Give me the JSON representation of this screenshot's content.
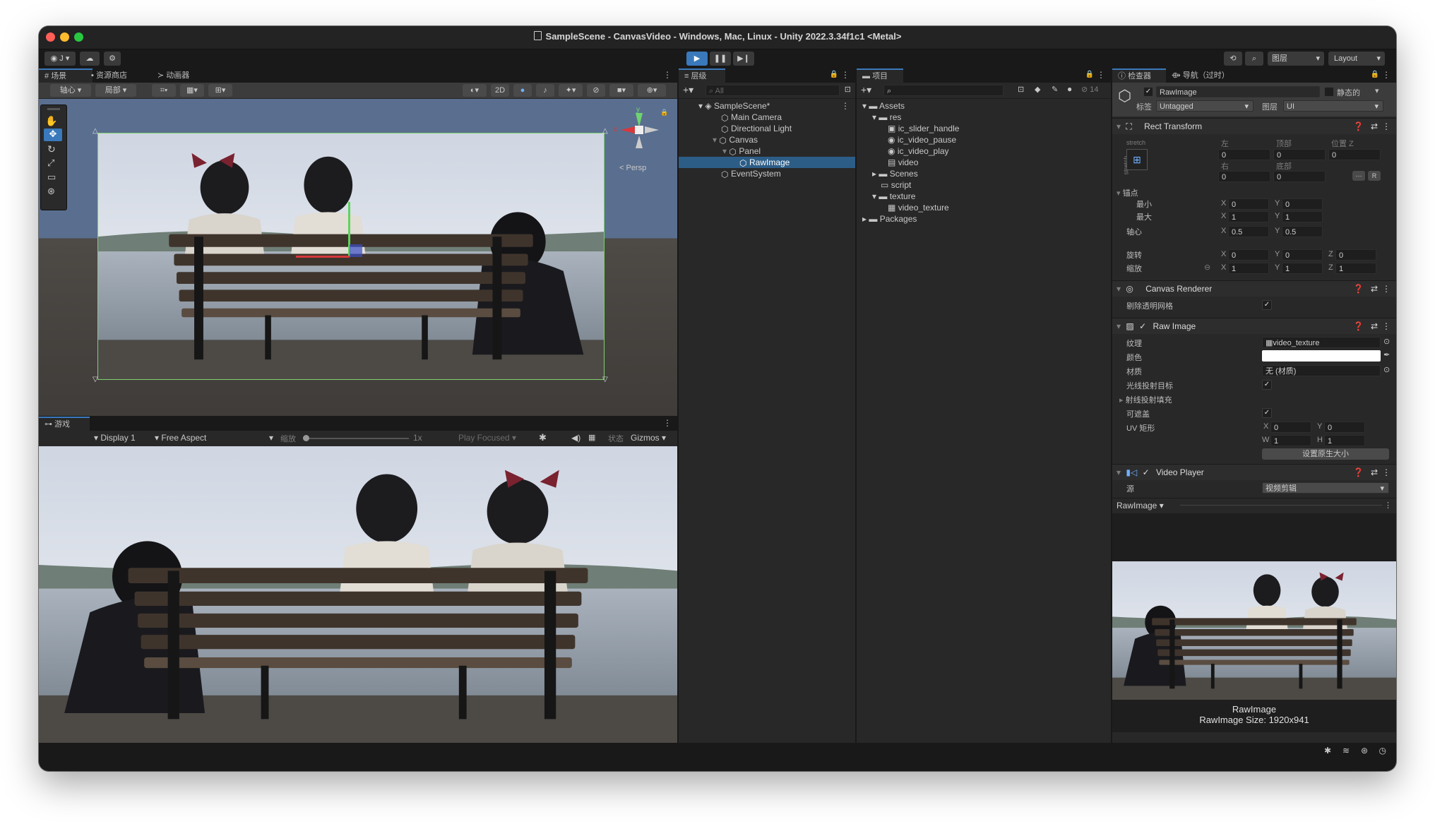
{
  "window": {
    "title": "SampleScene - CanvasVideo - Windows, Mac, Linux - Unity 2022.3.34f1c1 <Metal>"
  },
  "toolbar": {
    "account": "J",
    "layers": "图层",
    "layout": "Layout"
  },
  "scene_panel": {
    "tabs": [
      "场景",
      "资源商店",
      "动画器"
    ],
    "pivot": "轴心",
    "local": "局部",
    "mode_2d": "2D",
    "persp": "< Persp",
    "gizmo_x": "x",
    "gizmo_y": "y"
  },
  "game_panel": {
    "tab": "游戏",
    "display": "Display 1",
    "aspect": "Free Aspect",
    "scale_label": "缩放",
    "scale_value": "1x",
    "play_focused": "Play Focused",
    "stats": "状态",
    "gizmos": "Gizmos"
  },
  "hierarchy": {
    "tab": "层级",
    "search_placeholder": "All",
    "items": [
      {
        "label": "SampleScene*",
        "depth": 0,
        "selected": false
      },
      {
        "label": "Main Camera",
        "depth": 1,
        "selected": false
      },
      {
        "label": "Directional Light",
        "depth": 1,
        "selected": false
      },
      {
        "label": "Canvas",
        "depth": 1,
        "selected": false
      },
      {
        "label": "Panel",
        "depth": 2,
        "selected": false
      },
      {
        "label": "RawImage",
        "depth": 3,
        "selected": true
      },
      {
        "label": "EventSystem",
        "depth": 1,
        "selected": false
      }
    ]
  },
  "project": {
    "tab": "项目",
    "hidden_count": "14",
    "items": [
      {
        "label": "Assets",
        "depth": 0,
        "kind": "folder"
      },
      {
        "label": "res",
        "depth": 1,
        "kind": "folder"
      },
      {
        "label": "ic_slider_handle",
        "depth": 2,
        "kind": "file"
      },
      {
        "label": "ic_video_pause",
        "depth": 2,
        "kind": "file"
      },
      {
        "label": "ic_video_play",
        "depth": 2,
        "kind": "file"
      },
      {
        "label": "video",
        "depth": 2,
        "kind": "file"
      },
      {
        "label": "Scenes",
        "depth": 1,
        "kind": "folder"
      },
      {
        "label": "script",
        "depth": 1,
        "kind": "folder"
      },
      {
        "label": "texture",
        "depth": 1,
        "kind": "folder"
      },
      {
        "label": "video_texture",
        "depth": 2,
        "kind": "file"
      },
      {
        "label": "Packages",
        "depth": 0,
        "kind": "folder"
      }
    ]
  },
  "inspector": {
    "tabs": [
      "检查器",
      "导航（过时）"
    ],
    "object_name": "RawImage",
    "static_label": "静态的",
    "tag_label": "标签",
    "tag_value": "Untagged",
    "layer_label": "图层",
    "layer_value": "UI",
    "rect_transform": {
      "title": "Rect Transform",
      "stretch": "stretch",
      "stretch_v": "stretch",
      "left_label": "左",
      "top_label": "顶部",
      "posz_label": "位置 Z",
      "left": "0",
      "top": "0",
      "posz": "0",
      "right_label": "右",
      "bottom_label": "底部",
      "right": "0",
      "bottom": "0",
      "anchors_label": "锚点",
      "min_label": "最小",
      "max_label": "最大",
      "pivot_label": "轴心",
      "rotation_label": "旋转",
      "scale_label": "缩放",
      "min_x": "0",
      "min_y": "0",
      "max_x": "1",
      "max_y": "1",
      "pivot_x": "0.5",
      "pivot_y": "0.5",
      "rot_x": "0",
      "rot_y": "0",
      "rot_z": "0",
      "scale_x": "1",
      "scale_y": "1",
      "scale_z": "1",
      "r_button": "R"
    },
    "canvas_renderer": {
      "title": "Canvas Renderer",
      "cull_label": "剔除透明网格"
    },
    "raw_image": {
      "title": "Raw Image",
      "texture_label": "纹理",
      "texture_value": "video_texture",
      "color_label": "颜色",
      "material_label": "材质",
      "material_value": "无 (材质)",
      "raycast_label": "光线投射目标",
      "padding_label": "射线投射填充",
      "maskable_label": "可遮盖",
      "uv_label": "UV 矩形",
      "uv_x": "0",
      "uv_y": "0",
      "uv_w": "1",
      "uv_h": "1",
      "native_size_button": "设置原生大小"
    },
    "video_player": {
      "title": "Video Player",
      "source_label": "源",
      "source_value": "视频剪辑"
    },
    "preview": {
      "header": "RawImage",
      "name": "RawImage",
      "size": "RawImage Size: 1920x941"
    }
  },
  "colors": {
    "accent": "#3a79bb",
    "selection": "#2c5d87",
    "window_bg": "#191919",
    "panel_bg": "#282828"
  }
}
